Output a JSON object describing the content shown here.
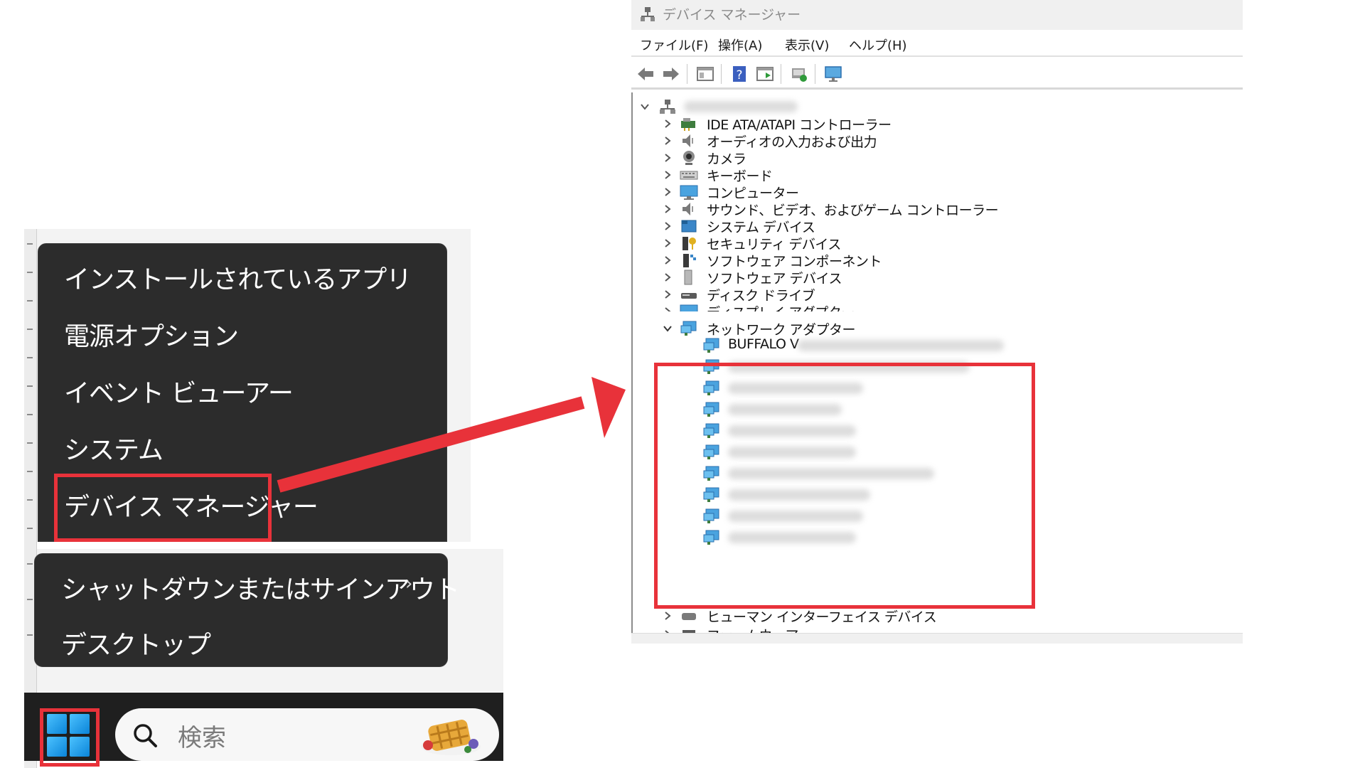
{
  "start_menu": {
    "items": [
      {
        "label": "インストールされているアプリ"
      },
      {
        "label": "電源オプション"
      },
      {
        "label": "イベント ビューアー"
      },
      {
        "label": "システム"
      },
      {
        "label": "デバイス マネージャー"
      }
    ],
    "lower_items": [
      {
        "label": "シャットダウンまたはサインアウト",
        "chevron": "›"
      },
      {
        "label": "デスクトップ"
      }
    ]
  },
  "taskbar": {
    "search_placeholder": "検索",
    "start_icon": "windows-logo-icon",
    "widget_icon": "waffle-widget-icon"
  },
  "device_manager": {
    "title": "デバイス マネージャー",
    "menu": [
      {
        "label": "ファイル(F)"
      },
      {
        "label": "操作(A)"
      },
      {
        "label": "表示(V)"
      },
      {
        "label": "ヘルプ(H)"
      }
    ],
    "toolbar_icons": [
      "back-icon",
      "forward-icon",
      "properties-icon",
      "help-icon",
      "update-driver-icon",
      "scan-hardware-icon",
      "monitor-icon"
    ],
    "categories": [
      {
        "label": "IDE ATA/ATAPI コントローラー",
        "icon": "ide-controller-icon"
      },
      {
        "label": "オーディオの入力および出力",
        "icon": "audio-io-icon"
      },
      {
        "label": "カメラ",
        "icon": "camera-icon"
      },
      {
        "label": "キーボード",
        "icon": "keyboard-icon"
      },
      {
        "label": "コンピューター",
        "icon": "computer-icon"
      },
      {
        "label": "サウンド、ビデオ、およびゲーム コントローラー",
        "icon": "sound-video-icon"
      },
      {
        "label": "システム デバイス",
        "icon": "system-devices-icon"
      },
      {
        "label": "セキュリティ デバイス",
        "icon": "security-devices-icon"
      },
      {
        "label": "ソフトウェア コンポーネント",
        "icon": "software-component-icon"
      },
      {
        "label": "ソフトウェア デバイス",
        "icon": "software-devices-icon"
      },
      {
        "label": "ディスク ドライブ",
        "icon": "disk-drive-icon"
      },
      {
        "label": "ディスプレイ アダプター",
        "icon": "display-adapter-icon"
      }
    ],
    "network": {
      "label": "ネットワーク アダプター",
      "first_adapter": "BUFFALO V"
    },
    "after_categories": [
      {
        "label": "ヒューマン インターフェイス デバイス",
        "icon": "hid-icon"
      },
      {
        "label": "ファームウェア",
        "icon": "firmware-icon"
      }
    ]
  },
  "colors": {
    "highlight_red": "#e8323a",
    "menu_bg": "#2c2c2c",
    "taskbar_bg": "#1f1f1f",
    "windows_blue": "#0a84d8"
  }
}
